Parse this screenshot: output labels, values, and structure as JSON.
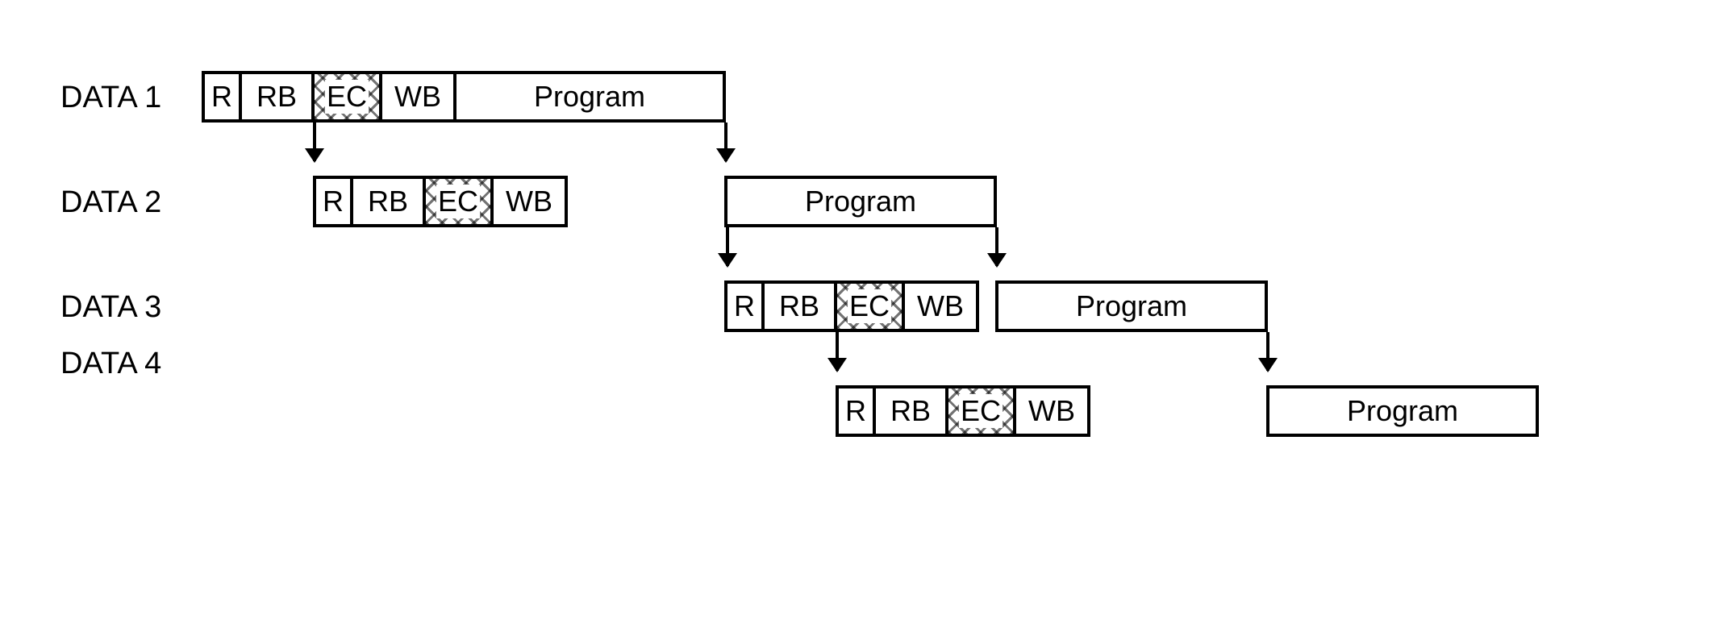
{
  "labels": {
    "data1": "DATA 1",
    "data2": "DATA 2",
    "data3": "DATA 3",
    "data4": "DATA 4"
  },
  "stages": {
    "r": "R",
    "rb": "RB",
    "ec": "EC",
    "wb": "WB",
    "program": "Program"
  },
  "chart_data": {
    "type": "table",
    "title": "Pipelined execution timing diagram (4 data items)",
    "rows": [
      "DATA 1",
      "DATA 2",
      "DATA 3",
      "DATA 4"
    ],
    "stage_sequence": [
      "R",
      "RB",
      "EC",
      "WB",
      "Program"
    ],
    "stage_widths_relative": {
      "R": 1,
      "RB": 2,
      "EC": 2,
      "WB": 2,
      "Program": 7
    },
    "schedule_start_offset_units": {
      "DATA 1": 0,
      "DATA 2": 3,
      "DATA 3": 11,
      "DATA 4": 14
    },
    "dependencies": [
      {
        "from": "DATA 1 RB end",
        "to": "DATA 2 R start"
      },
      {
        "from": "DATA 1 Program end",
        "to": "DATA 2 Program start"
      },
      {
        "from": "DATA 2 Program start",
        "to": "DATA 3 R start"
      },
      {
        "from": "DATA 2 Program end",
        "to": "DATA 3 Program start"
      },
      {
        "from": "DATA 3 RB end",
        "to": "DATA 4 R start"
      },
      {
        "from": "DATA 3 Program end",
        "to": "DATA 4 Program start"
      }
    ],
    "ec_highlight": true
  }
}
